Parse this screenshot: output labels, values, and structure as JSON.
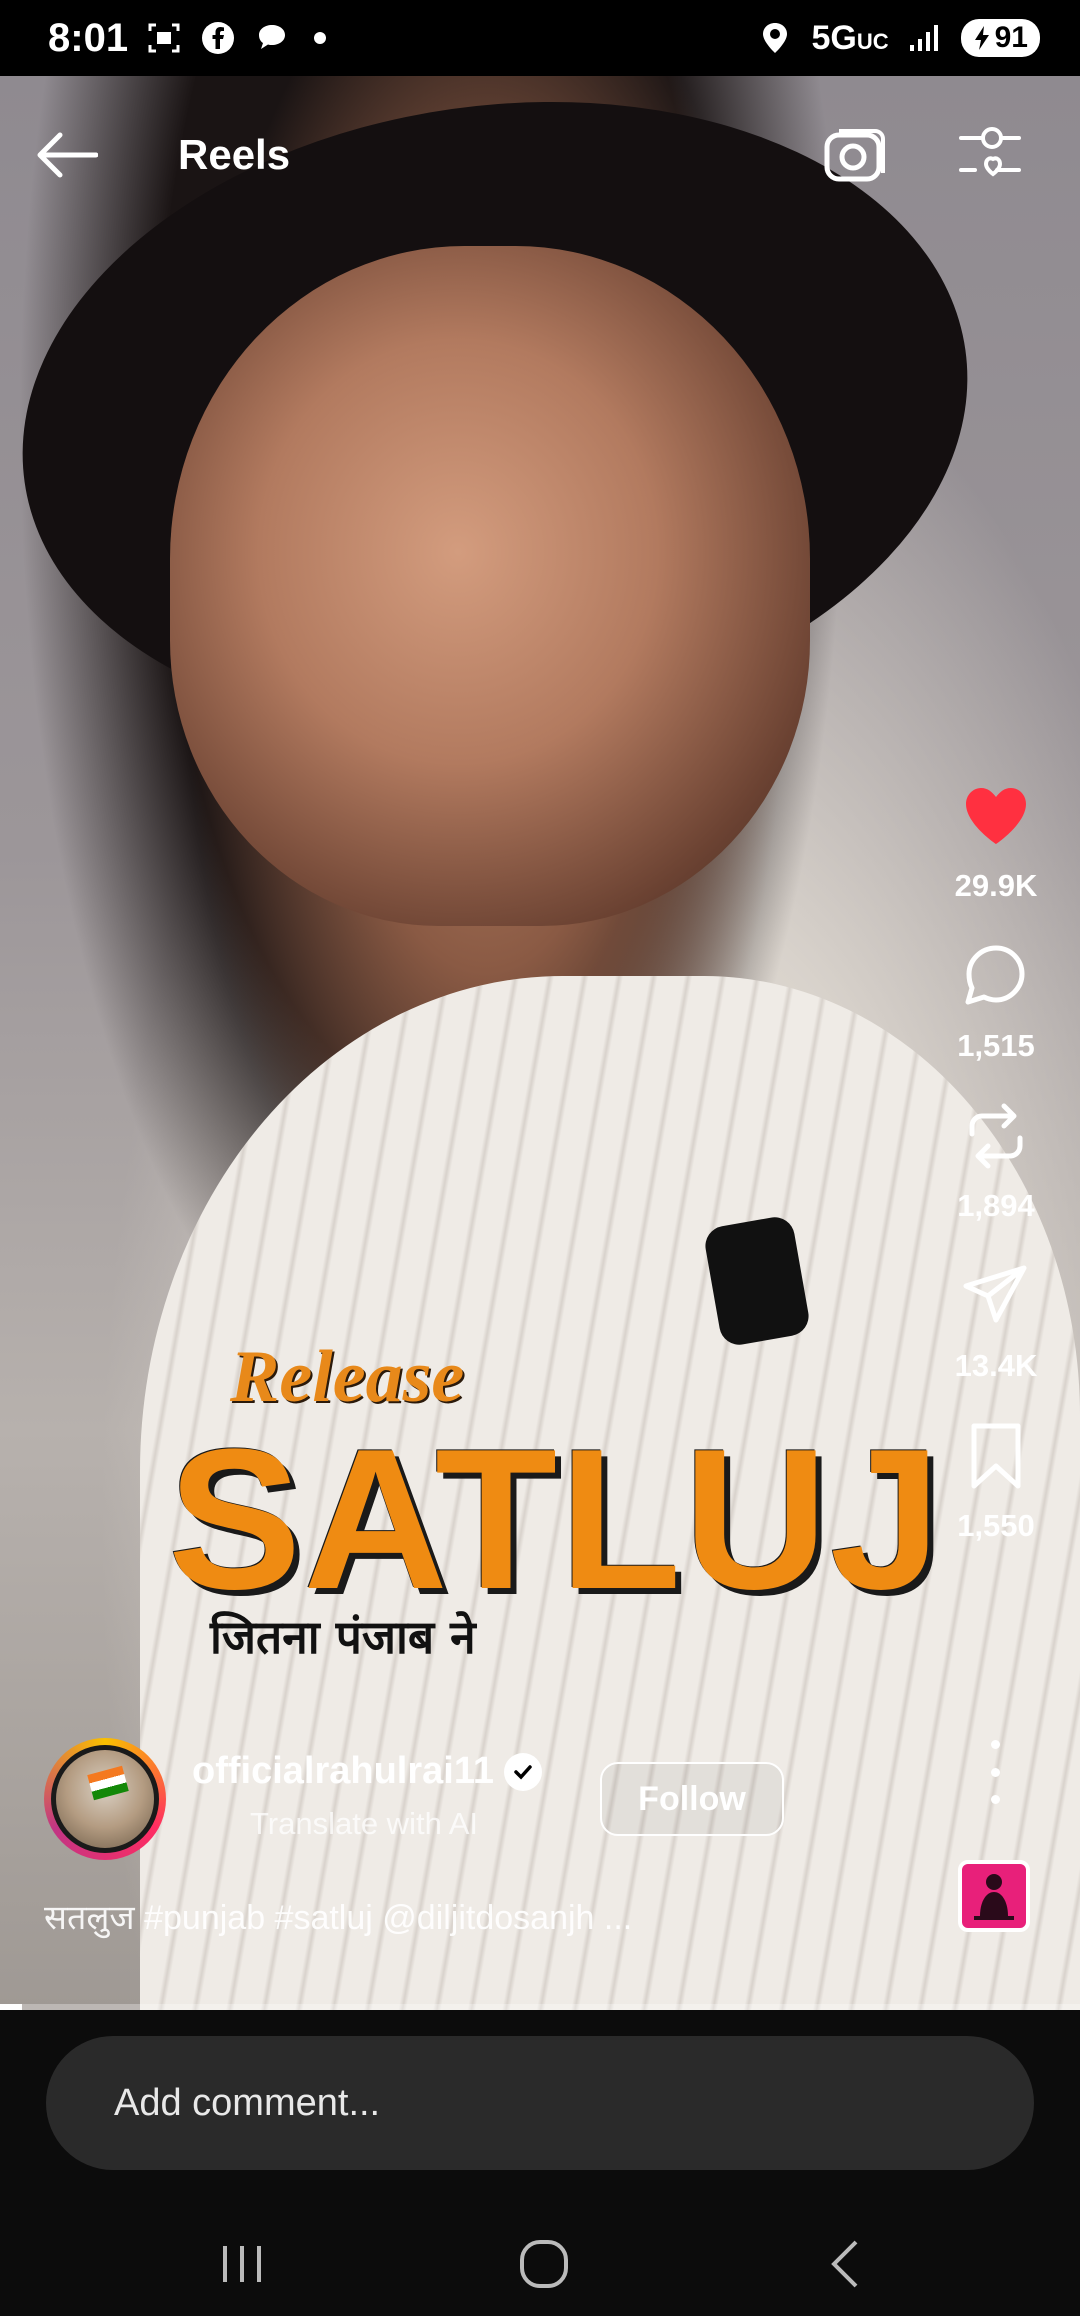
{
  "status_bar": {
    "time": "8:01",
    "network": "5G",
    "network_sub": "UC",
    "battery": "91"
  },
  "header": {
    "title": "Reels"
  },
  "video_overlay": {
    "release_text": "Release",
    "title_text": "SATLUJ",
    "subtitle_text": "जितना पंजाब ने"
  },
  "actions": {
    "likes": "29.9K",
    "comments": "1,515",
    "reposts": "1,894",
    "shares": "13.4K",
    "saves": "1,550"
  },
  "author": {
    "username": "officialrahulrai11",
    "translate_label": "Translate with AI",
    "follow_label": "Follow"
  },
  "caption": "सतलुज #punjab #satluj @diljitdosanjh ...",
  "progress": 0.02,
  "comment_box": {
    "placeholder": "Add comment..."
  },
  "colors": {
    "like_red": "#ff3040",
    "accent_orange": "#ef8b12"
  }
}
